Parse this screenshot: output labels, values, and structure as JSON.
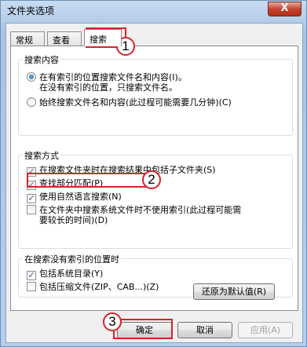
{
  "window": {
    "title": "文件夹选项",
    "close_glyph": "X"
  },
  "tabs": [
    {
      "label": "常规"
    },
    {
      "label": "查看"
    },
    {
      "label": "搜索"
    }
  ],
  "search_content": {
    "title": "搜索内容",
    "option1_line1": "在有索引的位置搜索文件名和内容(I)。",
    "option1_line2": "在没有索引的位置，只搜索文件名。",
    "option2": "始终搜索文件名和内容(此过程可能需要几分钟)(C)",
    "selected": 0
  },
  "search_method": {
    "title": "搜索方式",
    "items": [
      {
        "label": "在搜索文件夹时在搜索结果中包括子文件夹(S)",
        "checked": true
      },
      {
        "label": "查找部分匹配(P)",
        "checked": true
      },
      {
        "label": "使用自然语言搜索(N)",
        "checked": true
      },
      {
        "label": "在文件夹中搜索系统文件时不使用索引(此过程可能需",
        "label2": "要较长的时间)(D)",
        "checked": false
      }
    ]
  },
  "no_index": {
    "title": "在搜索没有索引的位置时",
    "items": [
      {
        "label": "包括系统目录(Y)",
        "checked": true
      },
      {
        "label": "包括压缩文件(ZIP、CAB...)(Z)",
        "checked": false
      }
    ]
  },
  "buttons": {
    "restore": "还原为默认值(R)",
    "ok": "确定",
    "cancel": "取消",
    "apply": "应用(A)"
  },
  "callouts": [
    "1",
    "2",
    "3"
  ],
  "colors": {
    "callout_red": "#d8232a",
    "titlebar": "#b9d1ea"
  }
}
